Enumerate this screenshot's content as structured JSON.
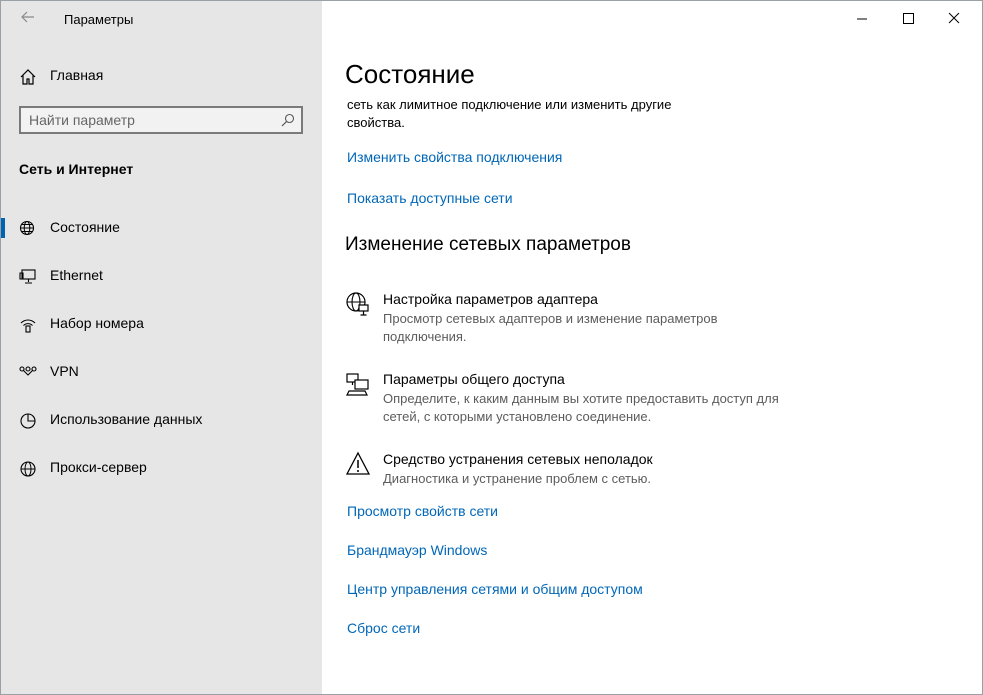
{
  "window": {
    "title": "Параметры"
  },
  "sidebar": {
    "home_label": "Главная",
    "search_placeholder": "Найти параметр",
    "section_title": "Сеть и Интернет",
    "items": [
      {
        "label": "Состояние",
        "icon": "globe-monitor-icon",
        "active": true
      },
      {
        "label": "Ethernet",
        "icon": "ethernet-monitor-icon",
        "active": false
      },
      {
        "label": "Набор номера",
        "icon": "dialup-icon",
        "active": false
      },
      {
        "label": "VPN",
        "icon": "vpn-icon",
        "active": false
      },
      {
        "label": "Использование данных",
        "icon": "data-usage-icon",
        "active": false
      },
      {
        "label": "Прокси-сервер",
        "icon": "globe-icon",
        "active": false
      }
    ]
  },
  "main": {
    "title": "Состояние",
    "description": "сеть как лимитное подключение или изменить другие свойства.",
    "links_top": [
      "Изменить свойства подключения",
      "Показать доступные сети"
    ],
    "subheading": "Изменение сетевых параметров",
    "options": [
      {
        "title": "Настройка параметров адаптера",
        "desc": "Просмотр сетевых адаптеров и изменение параметров подключения.",
        "icon": "adapter-icon"
      },
      {
        "title": "Параметры общего доступа",
        "desc": "Определите, к каким данным вы хотите предоставить доступ для сетей, с которыми установлено соединение.",
        "icon": "sharing-icon"
      },
      {
        "title": "Средство устранения сетевых неполадок",
        "desc": "Диагностика и устранение проблем с сетью.",
        "icon": "warning-icon"
      }
    ],
    "links_bottom": [
      "Просмотр свойств сети",
      "Брандмауэр Windows",
      "Центр управления сетями и общим доступом",
      "Сброс сети"
    ]
  },
  "colors": {
    "accent": "#0063b1",
    "link": "#0067b8",
    "sidebar_bg": "#e6e6e6"
  }
}
